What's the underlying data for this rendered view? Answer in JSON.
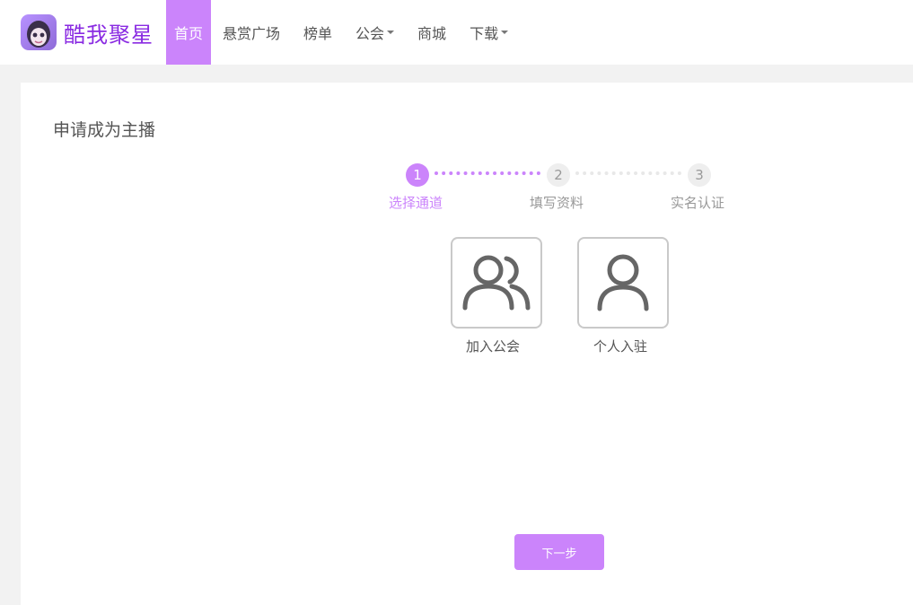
{
  "brand": {
    "name": "酷我聚星"
  },
  "nav": {
    "home": "首页",
    "bounty": "悬赏广场",
    "rank": "榜单",
    "guild": "公会",
    "shop": "商城",
    "download": "下载"
  },
  "page": {
    "title": "申请成为主播"
  },
  "steps": [
    {
      "number": "1",
      "label": "选择通道"
    },
    {
      "number": "2",
      "label": "填写资料"
    },
    {
      "number": "3",
      "label": "实名认证"
    }
  ],
  "options": {
    "join_guild": {
      "label": "加入公会",
      "icon": "group-users-icon"
    },
    "individual": {
      "label": "个人入驻",
      "icon": "single-user-icon"
    }
  },
  "actions": {
    "next": "下一步"
  },
  "colors": {
    "accent": "#cb84fb",
    "brand_text": "#8a2be2"
  }
}
